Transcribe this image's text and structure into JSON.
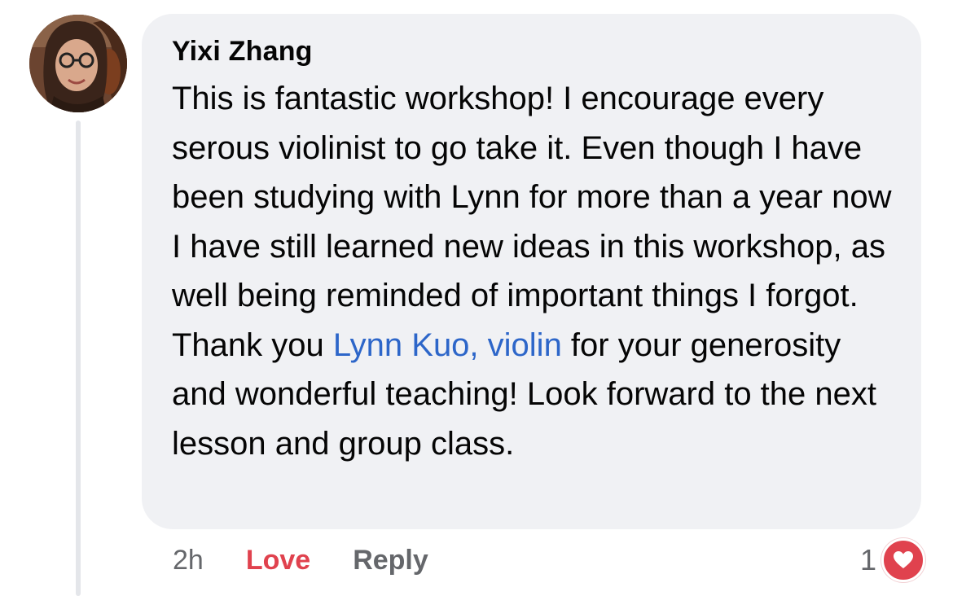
{
  "comment": {
    "author": "Yixi Zhang",
    "text_before_mention": "This is fantastic workshop! I encourage every serous violinist to go take it. Even though I have been studying with Lynn for more than a year now I have still learned new ideas in this workshop, as well being reminded of important things I forgot. Thank you ",
    "mention": "Lynn Kuo, violin",
    "text_after_mention": " for your generosity and wonderful teaching! Look forward to the next lesson and group class."
  },
  "actions": {
    "time": "2h",
    "love_label": "Love",
    "reply_label": "Reply"
  },
  "reactions": {
    "count": "1",
    "icon": "heart-icon",
    "color": "#e0424e"
  },
  "colors": {
    "bubble": "#f0f1f4",
    "mention": "#2d66c9",
    "love": "#e0424e",
    "muted": "#65676b"
  }
}
